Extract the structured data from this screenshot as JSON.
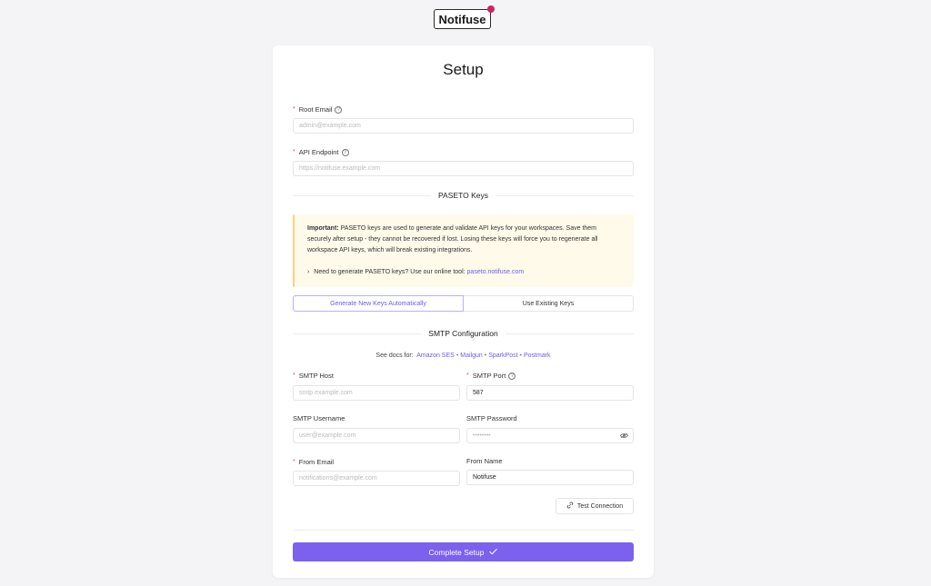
{
  "brand": {
    "name": "Notifuse",
    "dot_color": "#d1235f"
  },
  "page_title": "Setup",
  "root_email": {
    "label": "Root Email",
    "placeholder": "admin@example.com"
  },
  "api_endpoint": {
    "label": "API Endpoint",
    "placeholder": "https://notifuse.example.com"
  },
  "paseto": {
    "section_title": "PASETO Keys",
    "warning_bold": "Important:",
    "warning_text": "PASETO keys are used to generate and validate API keys for your workspaces. Save them securely after setup - they cannot be recovered if lost. Losing these keys will force you to regenerate all workspace API keys, which will break existing integrations.",
    "tool_text": "Need to generate PASETO keys? Use our online tool:",
    "tool_link": "paseto.notifuse.com",
    "mode_options": [
      "Generate New Keys Automatically",
      "Use Existing Keys"
    ],
    "selected_mode": "Generate New Keys Automatically"
  },
  "smtp": {
    "section_title": "SMTP Configuration",
    "docs_prefix": "See docs for:",
    "docs_links": [
      "Amazon SES",
      "Mailgun",
      "SparkPost",
      "Postmark"
    ],
    "host": {
      "label": "SMTP Host",
      "placeholder": "smtp.example.com"
    },
    "port": {
      "label": "SMTP Port",
      "value": "587"
    },
    "username": {
      "label": "SMTP Username",
      "placeholder": "user@example.com"
    },
    "password": {
      "label": "SMTP Password",
      "placeholder": "••••••••"
    },
    "from_email": {
      "label": "From Email",
      "placeholder": "notifications@example.com"
    },
    "from_name": {
      "label": "From Name",
      "value": "Notifuse"
    },
    "test_button": "Test Connection"
  },
  "submit_label": "Complete Setup",
  "accent_color": "#7b61ee",
  "icons": [
    "help-circle-icon",
    "eye-icon",
    "link-icon",
    "check-icon"
  ]
}
